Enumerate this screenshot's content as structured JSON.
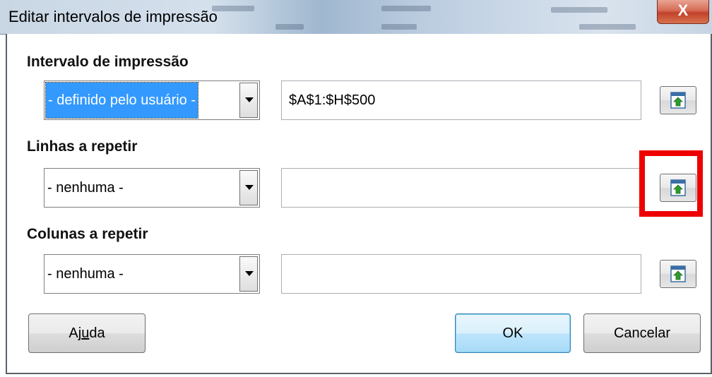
{
  "window": {
    "title": "Editar intervalos de impressão",
    "close_glyph": "X"
  },
  "print_range": {
    "label": "Intervalo de impressão",
    "selected": "- definido pelo usuário -",
    "value": "$A$1:$H$500",
    "shrink_icon": "shrink-range-icon"
  },
  "rows_to_repeat": {
    "label": "Linhas a repetir",
    "selected": "- nenhuma -",
    "value": "",
    "shrink_icon": "shrink-range-icon"
  },
  "columns_to_repeat": {
    "label": "Colunas a repetir",
    "selected": "- nenhuma -",
    "value": "",
    "shrink_icon": "shrink-range-icon"
  },
  "buttons": {
    "help_before": "Aj",
    "help_accel": "u",
    "help_after": "da",
    "ok": "OK",
    "cancel": "Cancelar"
  },
  "colors": {
    "highlight": "#ee0000",
    "selection": "#3399ff"
  }
}
